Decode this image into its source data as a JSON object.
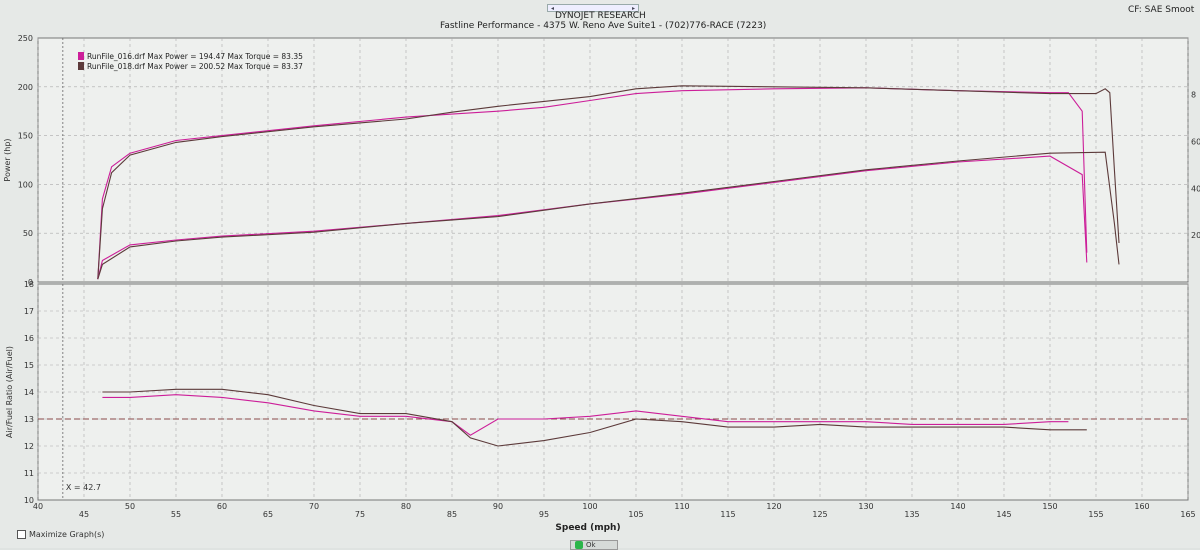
{
  "header": {
    "brand": "DYNOJET RESEARCH",
    "shop_line": "Fastline Performance - 4375 W. Reno Ave Suite1 - (702)776-RACE (7223)",
    "correction": "CF: SAE  Smoot",
    "scroll_left": "◂",
    "scroll_right": "▸"
  },
  "footer": {
    "maximize_label": "Maximize Graph(s)",
    "ok_label": "Ok"
  },
  "colors": {
    "run16": "#cc1e99",
    "run18": "#5c3a3a",
    "grid": "#aaaaaa"
  },
  "chart_data": [
    {
      "type": "line",
      "ylabel": "Power (hp)",
      "ylim": [
        0,
        250
      ],
      "yticks": [
        0,
        50,
        100,
        150,
        200,
        250
      ],
      "right_ticks": [
        "20",
        "40",
        "60",
        "8"
      ],
      "legend": [
        {
          "name": "RunFile_016.drf Max Power = 194.47 Max Torque = 83.35",
          "color": "#cc1e99"
        },
        {
          "name": "RunFile_018.drf Max Power = 200.52 Max Torque = 83.37",
          "color": "#5c3a3a"
        }
      ],
      "series": [
        {
          "name": "RunFile_016.drf",
          "metric": "power",
          "x": [
            46.5,
            47,
            48,
            50,
            55,
            60,
            70,
            80,
            85,
            90,
            95,
            100,
            105,
            110,
            120,
            130,
            140,
            150,
            152,
            153.5,
            154
          ],
          "y": [
            3,
            85,
            118,
            132,
            145,
            150,
            160,
            169,
            172,
            175,
            179,
            186,
            193,
            196,
            198,
            199,
            196,
            194,
            194,
            175,
            30
          ]
        },
        {
          "name": "RunFile_018.drf",
          "metric": "power",
          "x": [
            46.5,
            47,
            48,
            50,
            55,
            60,
            70,
            80,
            85,
            90,
            95,
            100,
            105,
            110,
            120,
            130,
            140,
            150,
            155,
            156,
            156.5,
            157,
            157.5
          ],
          "y": [
            3,
            75,
            112,
            130,
            143,
            149,
            159,
            167,
            174,
            180,
            185,
            190,
            198,
            201,
            200,
            199,
            196,
            193,
            193,
            198,
            194,
            115,
            40
          ]
        },
        {
          "name": "RunFile_016.drf",
          "metric": "torque",
          "x": [
            46.5,
            47,
            50,
            55,
            60,
            70,
            80,
            90,
            100,
            110,
            120,
            130,
            140,
            150,
            153.5,
            154
          ],
          "y": [
            3,
            22,
            38,
            43,
            47,
            52,
            60,
            68,
            80,
            90,
            102,
            114,
            123,
            129,
            110,
            20
          ]
        },
        {
          "name": "RunFile_018.drf",
          "metric": "torque",
          "x": [
            46.5,
            47,
            50,
            55,
            60,
            70,
            80,
            90,
            100,
            110,
            120,
            130,
            140,
            150,
            156,
            157,
            157.5
          ],
          "y": [
            3,
            18,
            36,
            42,
            46,
            51,
            60,
            67,
            80,
            91,
            103,
            115,
            124,
            132,
            133,
            60,
            18
          ]
        }
      ]
    },
    {
      "type": "line",
      "ylabel": "Air/Fuel Ratio (Air/Fuel)",
      "xlabel": "Speed (mph)",
      "ylim": [
        10,
        18
      ],
      "yticks": [
        10,
        11,
        12,
        13,
        14,
        15,
        16,
        17,
        18
      ],
      "xlim": [
        40,
        165
      ],
      "xticks": [
        40,
        45,
        50,
        55,
        60,
        65,
        70,
        75,
        80,
        85,
        90,
        95,
        100,
        105,
        110,
        115,
        120,
        125,
        130,
        135,
        140,
        145,
        150,
        155,
        160,
        165
      ],
      "reference_line": 13.0,
      "annotation": "X = 42.7",
      "series": [
        {
          "name": "RunFile_016.drf",
          "x": [
            47,
            50,
            55,
            60,
            65,
            70,
            75,
            80,
            85,
            87,
            90,
            95,
            100,
            105,
            110,
            115,
            120,
            125,
            130,
            135,
            140,
            145,
            150,
            152
          ],
          "y": [
            13.8,
            13.8,
            13.9,
            13.8,
            13.6,
            13.3,
            13.1,
            13.1,
            12.9,
            12.4,
            13.0,
            13.0,
            13.1,
            13.3,
            13.1,
            12.9,
            12.9,
            12.9,
            12.9,
            12.8,
            12.8,
            12.8,
            12.9,
            12.9
          ]
        },
        {
          "name": "RunFile_018.drf",
          "x": [
            47,
            50,
            55,
            60,
            65,
            70,
            75,
            80,
            85,
            87,
            90,
            95,
            100,
            105,
            110,
            115,
            120,
            125,
            130,
            135,
            140,
            145,
            150,
            154
          ],
          "y": [
            14.0,
            14.0,
            14.1,
            14.1,
            13.9,
            13.5,
            13.2,
            13.2,
            12.9,
            12.3,
            12.0,
            12.2,
            12.5,
            13.0,
            12.9,
            12.7,
            12.7,
            12.8,
            12.7,
            12.7,
            12.7,
            12.7,
            12.6,
            12.6
          ]
        }
      ]
    }
  ]
}
